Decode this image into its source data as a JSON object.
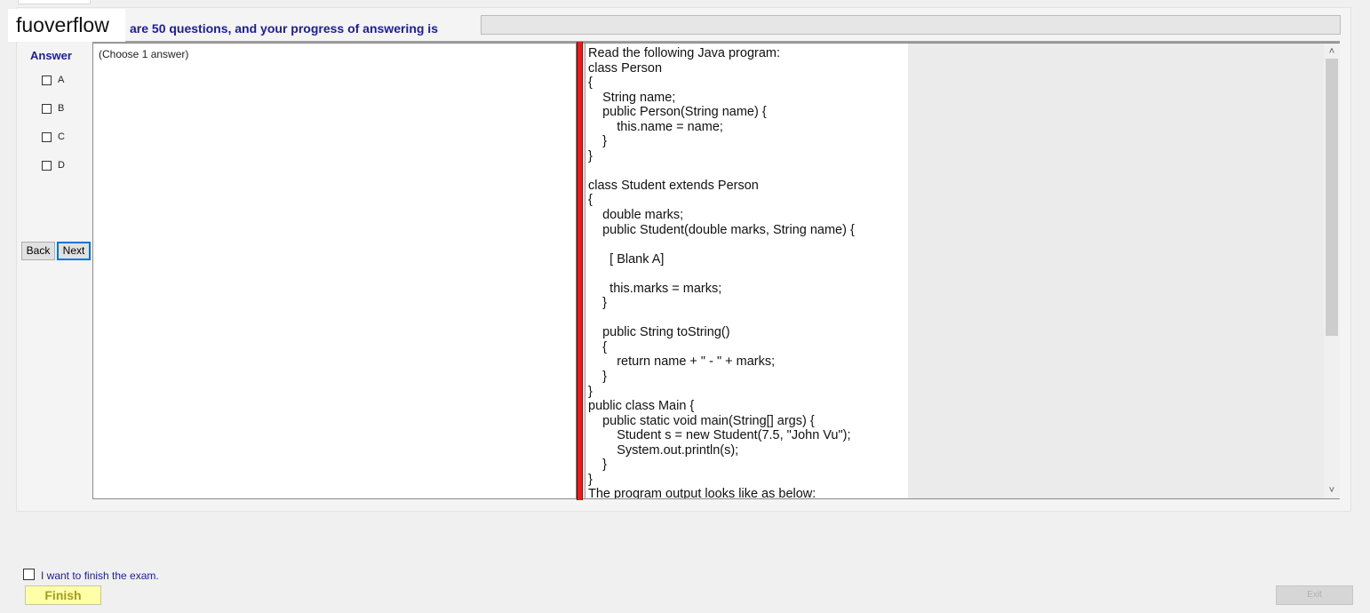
{
  "watermark": "fuoverflow",
  "header": {
    "progress_text": "are 50 questions, and your progress of answering is"
  },
  "progress": {
    "value": 0
  },
  "answer_panel": {
    "heading": "Answer",
    "options": [
      {
        "label": "A",
        "checked": false
      },
      {
        "label": "B",
        "checked": false
      },
      {
        "label": "C",
        "checked": false
      },
      {
        "label": "D",
        "checked": false
      }
    ],
    "back_label": "Back",
    "next_label": "Next",
    "choose_text": "(Choose 1 answer)"
  },
  "question": {
    "text": "Read the following Java program:\nclass Person\n{\n    String name;\n    public Person(String name) {\n        this.name = name;\n    }\n}\n\nclass Student extends Person\n{\n    double marks;\n    public Student(double marks, String name) {\n\n      [ Blank A]\n\n      this.marks = marks;\n    }\n\n    public String toString()\n    {\n        return name + \" - \" + marks;\n    }\n}\npublic class Main {\n    public static void main(String[] args) {\n        Student s = new Student(7.5, \"John Vu\");\n        System.out.println(s);\n    }\n}\nThe program output looks like as below:"
  },
  "scrollbar": {
    "up_glyph": "˄",
    "down_glyph": "˅"
  },
  "footer": {
    "finish_checkbox_label": "I want to finish the exam.",
    "finish_checked": false,
    "finish_label": "Finish",
    "exit_label": "Exit"
  },
  "colors": {
    "label_blue": "#1c1ca0",
    "splitter_red": "#ee1a1a",
    "finish_yellow": "#ffffa8"
  }
}
